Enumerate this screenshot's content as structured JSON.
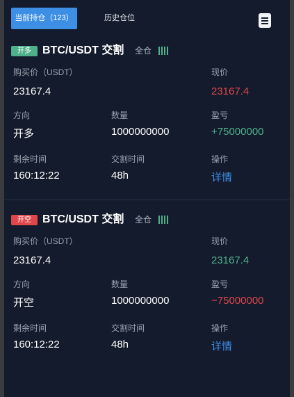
{
  "tabs": {
    "current_label": "当前持仓（123）",
    "history_label": "历史仓位"
  },
  "colors": {
    "accent": "#3d8ee5",
    "long_badge": "#4fb08c",
    "short_badge": "#e0474c",
    "positive": "#4fb08c",
    "negative": "#e0474c",
    "link": "#3d8ee5",
    "background": "#141b2c"
  },
  "icons": {
    "menu": "menu-icon",
    "leverage": "signal-bars-icon"
  },
  "labels": {
    "buy_price": "购买价（USDT）",
    "current_price": "现价",
    "direction": "方向",
    "quantity": "数量",
    "pnl": "盈亏",
    "remaining_time": "剩余时间",
    "delivery_time": "交割时间",
    "action": "操作"
  },
  "positions": [
    {
      "badge": "开多",
      "pair": "BTC/USDT 交割",
      "margin_mode": "全仓",
      "buy_price": "23167.4",
      "current_price": "23167.4",
      "direction": "开多",
      "quantity": "1000000000",
      "pnl": "+75000000",
      "remaining_time": "160:12:22",
      "delivery_time": "48h",
      "action": "详情"
    },
    {
      "badge": "开空",
      "pair": "BTC/USDT 交割",
      "margin_mode": "全仓",
      "buy_price": "23167.4",
      "current_price": "23167.4",
      "direction": "开空",
      "quantity": "1000000000",
      "pnl": "−75000000",
      "remaining_time": "160:12:22",
      "delivery_time": "48h",
      "action": "详情"
    }
  ]
}
